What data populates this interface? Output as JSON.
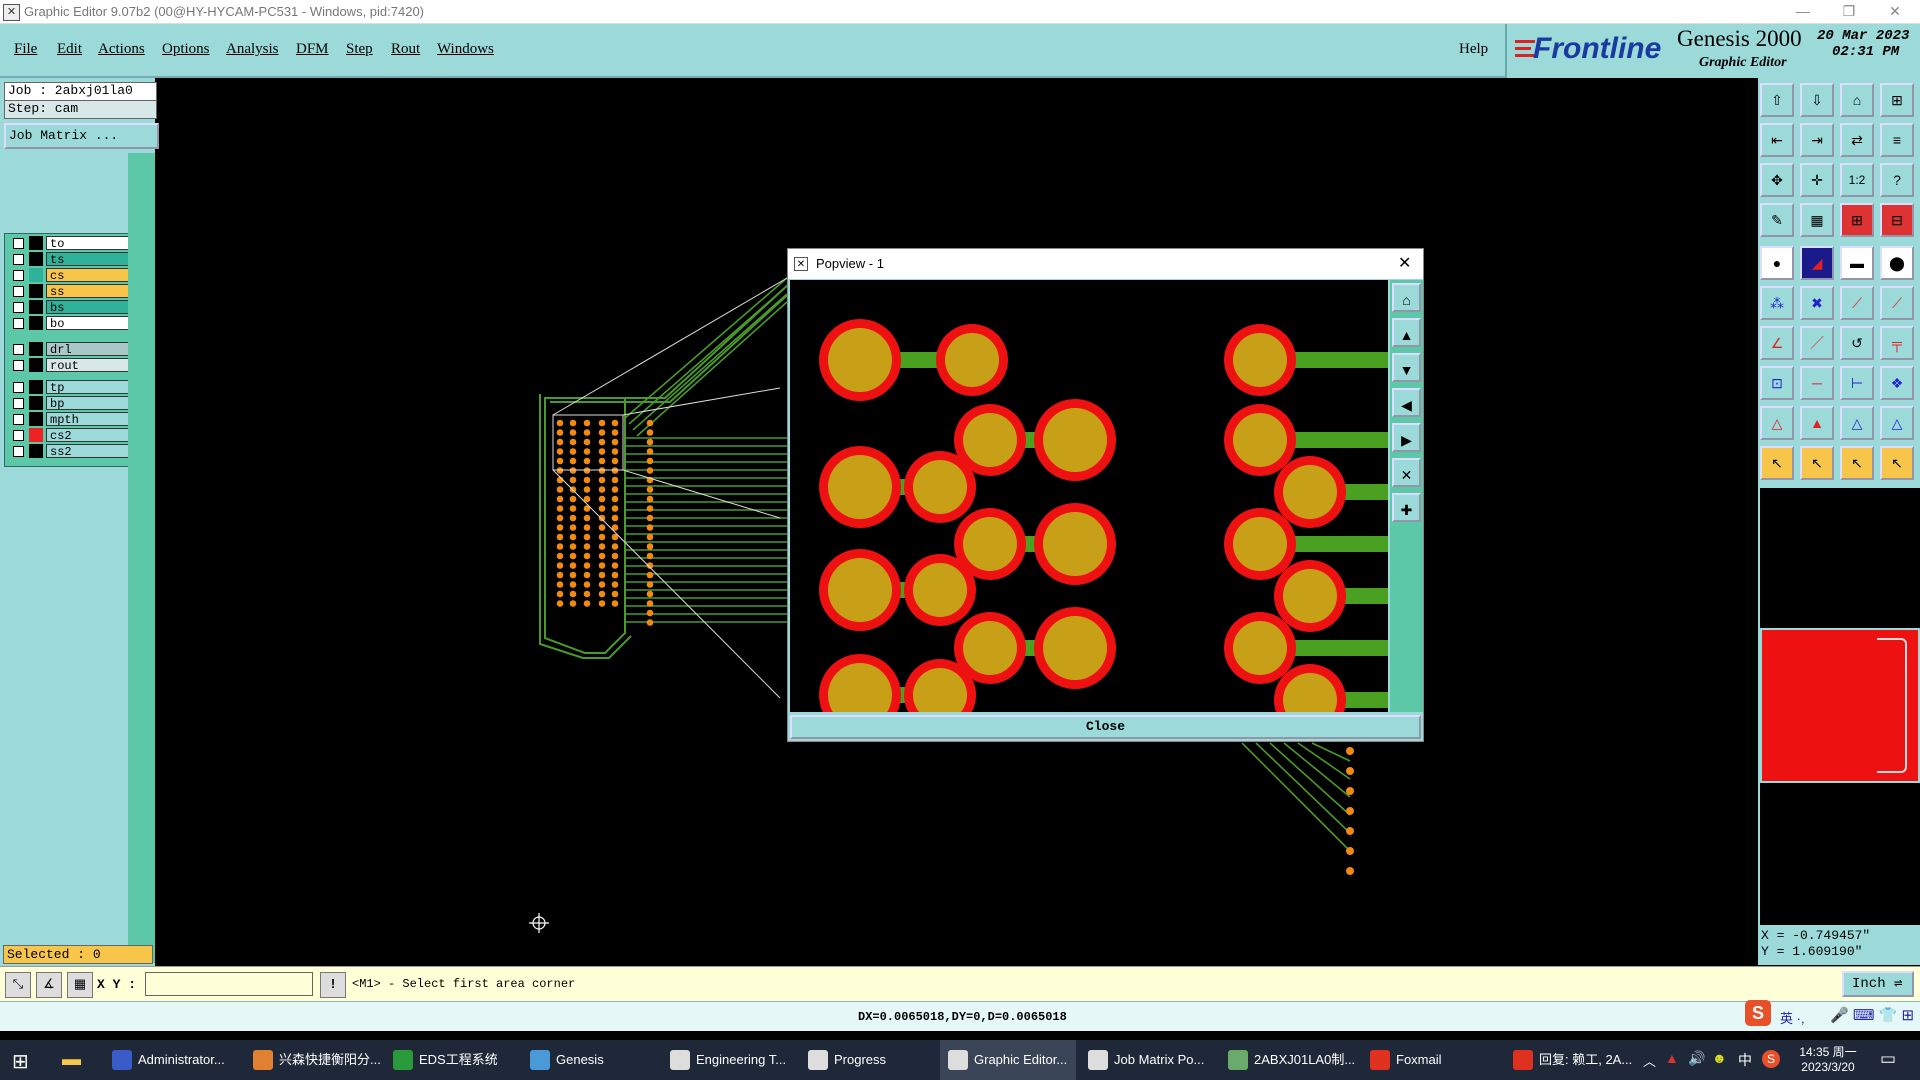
{
  "window": {
    "title": "Graphic Editor 9.07b2 (00@HY-HYCAM-PC531 - Windows, pid:7420)"
  },
  "menu": {
    "file": "File",
    "edit": "Edit",
    "actions": "Actions",
    "options": "Options",
    "analysis": "Analysis",
    "dfm": "DFM",
    "step": "Step",
    "rout": "Rout",
    "windows": "Windows",
    "help": "Help"
  },
  "branding": {
    "company": "Frontline",
    "product": "Genesis 2000",
    "subtitle": "Graphic Editor",
    "date": "20 Mar 2023",
    "time": "02:31 PM"
  },
  "job": {
    "job_label": "Job : 2abxj01la0",
    "step_label": "Step: cam",
    "matrix_button": "Job Matrix ..."
  },
  "layers": [
    {
      "name": "to",
      "color": "#ffffff",
      "mark": "#000000"
    },
    {
      "name": "ts",
      "color": "#2eb39a",
      "mark": "#000000"
    },
    {
      "name": "cs",
      "color": "#f7c54a",
      "mark": "#2eb39a"
    },
    {
      "name": "ss",
      "color": "#f7c54a",
      "mark": "#000000"
    },
    {
      "name": "bs",
      "color": "#2eb39a",
      "mark": "#000000"
    },
    {
      "name": "bo",
      "color": "#ffffff",
      "mark": "#000000"
    },
    {
      "name": "drl",
      "color": "#a8c8c8",
      "mark": "#000000"
    },
    {
      "name": "rout",
      "color": "#d8e8e8",
      "mark": "#000000"
    },
    {
      "name": "tp",
      "color": "#9cdada",
      "mark": "#000000"
    },
    {
      "name": "bp",
      "color": "#9cdada",
      "mark": "#000000"
    },
    {
      "name": "mpth",
      "color": "#9cdada",
      "mark": "#000000"
    },
    {
      "name": "cs2",
      "color": "#9cdada",
      "mark": "#ee2222"
    },
    {
      "name": "ss2",
      "color": "#9cdada",
      "mark": "#000000"
    }
  ],
  "status": {
    "selected": "Selected : 0",
    "xy_label": "X Y :",
    "xy_value": "",
    "prompt": "<M1> - Select first area corner",
    "units": "Inch",
    "measure": "DX=0.0065018,DY=0,D=0.0065018"
  },
  "coords": {
    "x": "X = -0.749457\"",
    "y": "Y =  1.609190\""
  },
  "popup": {
    "title": "Popview - 1",
    "close_label": "Close",
    "close_glyph": "✕"
  },
  "taskbar": {
    "items": [
      {
        "label": "Administrator...",
        "icon": "save-disk-icon",
        "color": "#3a5cc8"
      },
      {
        "label": "兴森快捷衡阳分...",
        "icon": "browser-icon",
        "color": "#e08030"
      },
      {
        "label": "EDS工程系统",
        "icon": "f-app-icon",
        "color": "#2a9a3a"
      },
      {
        "label": "Genesis",
        "icon": "genesis-icon",
        "color": "#4a9ad8"
      },
      {
        "label": "Engineering T...",
        "icon": "x-window-icon",
        "color": "#dddddd"
      },
      {
        "label": "Progress",
        "icon": "x-window-icon",
        "color": "#dddddd"
      },
      {
        "label": "Graphic Editor...",
        "icon": "x-window-icon",
        "color": "#dddddd"
      },
      {
        "label": "Job Matrix Po...",
        "icon": "x-window-icon",
        "color": "#dddddd"
      },
      {
        "label": "2ABXJ01LA0制...",
        "icon": "document-icon",
        "color": "#6aaa6a"
      },
      {
        "label": "Foxmail",
        "icon": "foxmail-icon",
        "color": "#e03020"
      },
      {
        "label": "回复: 赖工, 2A...",
        "icon": "foxmail-icon",
        "color": "#e03020"
      }
    ],
    "ime": "中",
    "clock_time": "14:35 周一",
    "clock_date": "2023/3/20",
    "ime_bar": "英 ·,"
  }
}
